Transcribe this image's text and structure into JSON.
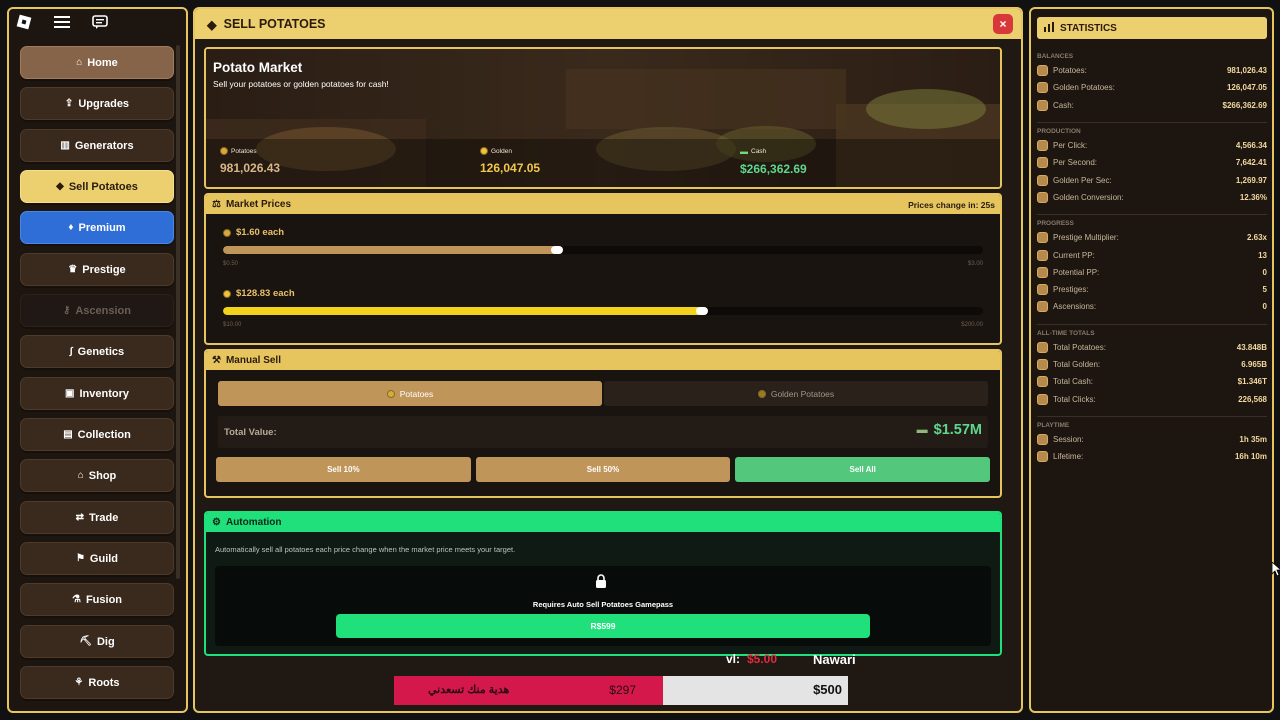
{
  "colors": {
    "accent": "#e6c55f",
    "green": "#1fe07a",
    "premium": "#2f6ed6",
    "close": "#d8383a"
  },
  "sidebar": {
    "items": [
      {
        "label": "Home",
        "icon": "home-icon"
      },
      {
        "label": "Upgrades",
        "icon": "upgrade-icon"
      },
      {
        "label": "Generators",
        "icon": "factory-icon"
      },
      {
        "label": "Sell Potatoes",
        "icon": "sell-icon"
      },
      {
        "label": "Premium",
        "icon": "diamond-icon"
      },
      {
        "label": "Prestige",
        "icon": "crown-icon"
      },
      {
        "label": "Ascension",
        "icon": "lock-icon"
      },
      {
        "label": "Genetics",
        "icon": "dna-icon"
      },
      {
        "label": "Inventory",
        "icon": "backpack-icon"
      },
      {
        "label": "Collection",
        "icon": "book-icon"
      },
      {
        "label": "Shop",
        "icon": "shop-icon"
      },
      {
        "label": "Trade",
        "icon": "trade-icon"
      },
      {
        "label": "Guild",
        "icon": "flag-icon"
      },
      {
        "label": "Fusion",
        "icon": "flask-icon"
      },
      {
        "label": "Dig",
        "icon": "shovel-icon"
      },
      {
        "label": "Roots",
        "icon": "root-icon"
      }
    ]
  },
  "main": {
    "title": "SELL POTATOES",
    "close": "×",
    "hero": {
      "title": "Potato Market",
      "subtitle": "Sell your potatoes or golden potatoes for cash!",
      "stats": [
        {
          "label": "Potatoes",
          "value": "981,026.43"
        },
        {
          "label": "Golden",
          "value": "126,047.05"
        },
        {
          "label": "Cash",
          "value": "$266,362.69"
        }
      ]
    },
    "market": {
      "title": "Market Prices",
      "timer": "Prices change in: 25s",
      "potato": {
        "price": "$1.60 each",
        "min": "$0.50",
        "max": "$3.00",
        "level": 0.44
      },
      "golden": {
        "price": "$128.83 each",
        "min": "$10.00",
        "max": "$200.00",
        "level": 0.63
      }
    },
    "manual": {
      "title": "Manual Sell",
      "tabs": [
        "Potatoes",
        "Golden Potatoes"
      ],
      "total_label": "Total Value:",
      "total_value": "$1.57M",
      "buttons": [
        "Sell 10%",
        "Sell 50%",
        "Sell All"
      ]
    },
    "automation": {
      "title": "Automation",
      "desc": "Automatically sell all potatoes each price change when the market price meets your target.",
      "requirement": "Requires Auto Sell Potatoes Gamepass",
      "buy_label": "R$599"
    }
  },
  "donation": {
    "donor": "vl:",
    "donor_amount": "$5.00",
    "name": "Nawari",
    "arabic": "هدية منك تسعدني",
    "raised": "$297",
    "goal": "$500"
  },
  "stats": {
    "title": "STATISTICS",
    "groups": [
      {
        "title": "BALANCES",
        "rows": [
          {
            "label": "Potatoes:",
            "value": "981,026.43"
          },
          {
            "label": "Golden Potatoes:",
            "value": "126,047.05"
          },
          {
            "label": "Cash:",
            "value": "$266,362.69"
          }
        ]
      },
      {
        "title": "PRODUCTION",
        "rows": [
          {
            "label": "Per Click:",
            "value": "4,566.34"
          },
          {
            "label": "Per Second:",
            "value": "7,642.41"
          },
          {
            "label": "Golden Per Sec:",
            "value": "1,269.97"
          },
          {
            "label": "Golden Conversion:",
            "value": "12.36%"
          }
        ]
      },
      {
        "title": "PROGRESS",
        "rows": [
          {
            "label": "Prestige Multiplier:",
            "value": "2.63x"
          },
          {
            "label": "Current PP:",
            "value": "13"
          },
          {
            "label": "Potential PP:",
            "value": "0"
          },
          {
            "label": "Prestiges:",
            "value": "5"
          },
          {
            "label": "Ascensions:",
            "value": "0"
          }
        ]
      },
      {
        "title": "ALL-TIME TOTALS",
        "rows": [
          {
            "label": "Total Potatoes:",
            "value": "43.848B"
          },
          {
            "label": "Total Golden:",
            "value": "6.965B"
          },
          {
            "label": "Total Cash:",
            "value": "$1.346T"
          },
          {
            "label": "Total Clicks:",
            "value": "226,568"
          }
        ]
      },
      {
        "title": "PLAYTIME",
        "rows": [
          {
            "label": "Session:",
            "value": "1h 35m"
          },
          {
            "label": "Lifetime:",
            "value": "16h 10m"
          }
        ]
      }
    ]
  }
}
